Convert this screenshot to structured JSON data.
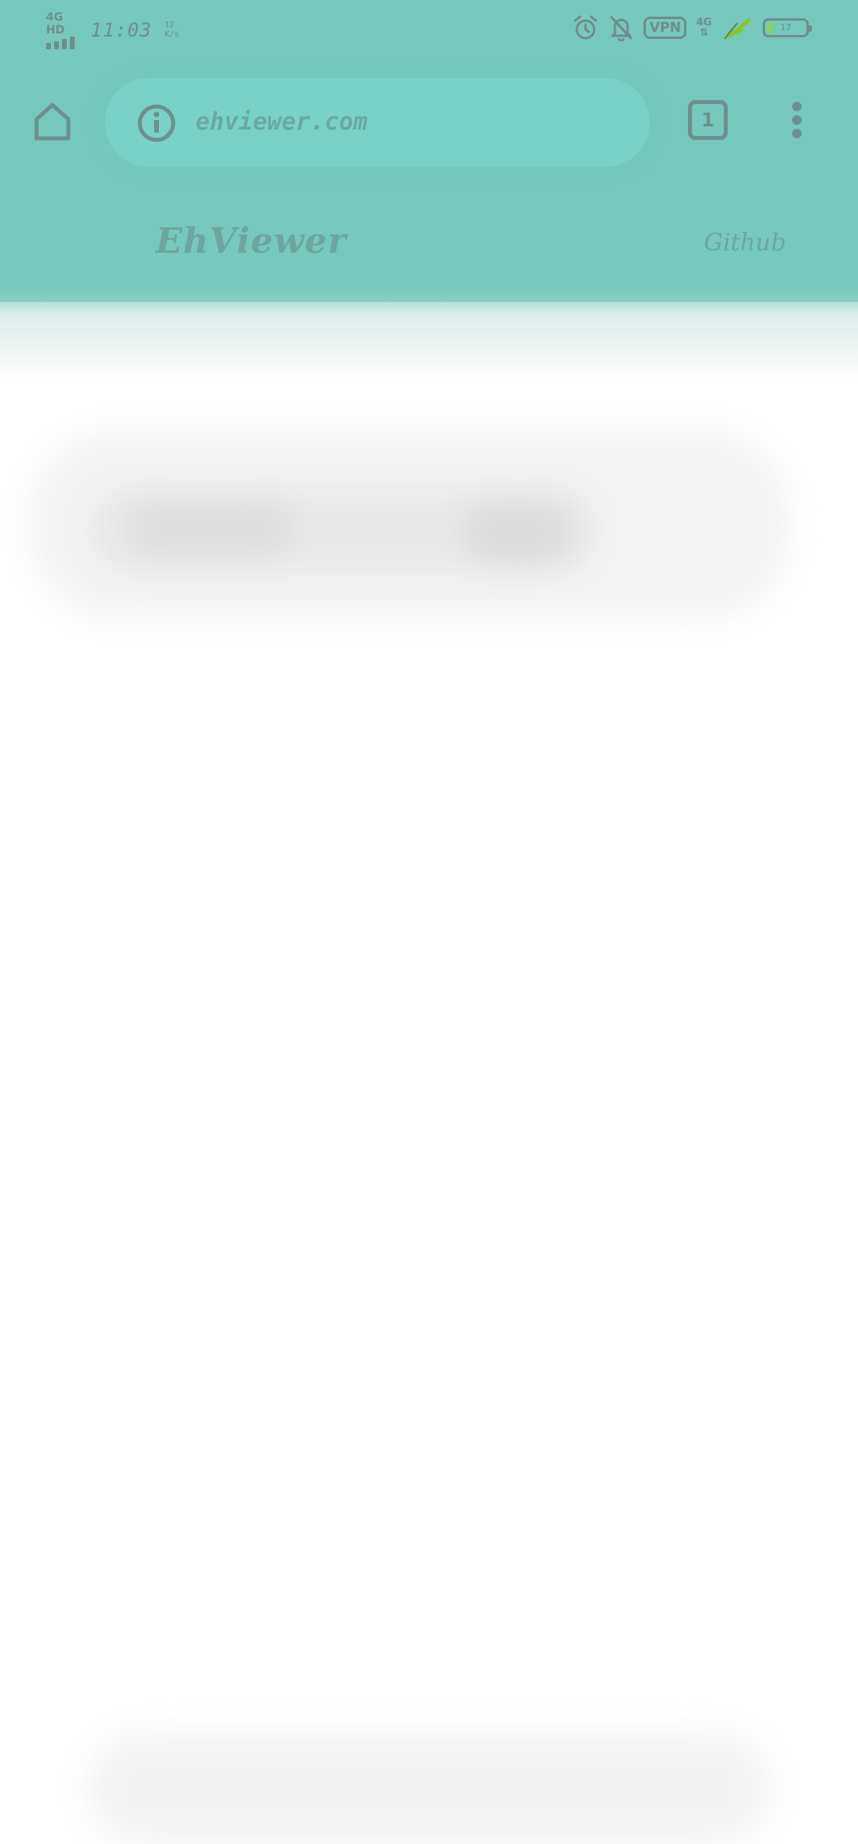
{
  "status_bar": {
    "network_label": "4G HD",
    "time": "11:03",
    "speed_value": "12",
    "speed_unit": "K/s",
    "icons": [
      "signal-icon",
      "alarm-icon",
      "notifications-off-icon",
      "vpn-icon",
      "mobile-data-icon",
      "charging-icon",
      "battery-icon"
    ],
    "vpn_label": "VPN",
    "data_label": "4G",
    "battery_level_text": "17",
    "battery_level_fraction": 0.17,
    "battery_fill_color": "#86d36a"
  },
  "browser": {
    "url": "ehviewer.com",
    "tab_count": "1",
    "home_icon": "home-icon",
    "info_icon": "info-icon",
    "menu_icon": "more-vert-icon",
    "toolbar_color": "#76c8bd"
  },
  "site": {
    "title": "EhViewer",
    "nav_link": "Github"
  }
}
